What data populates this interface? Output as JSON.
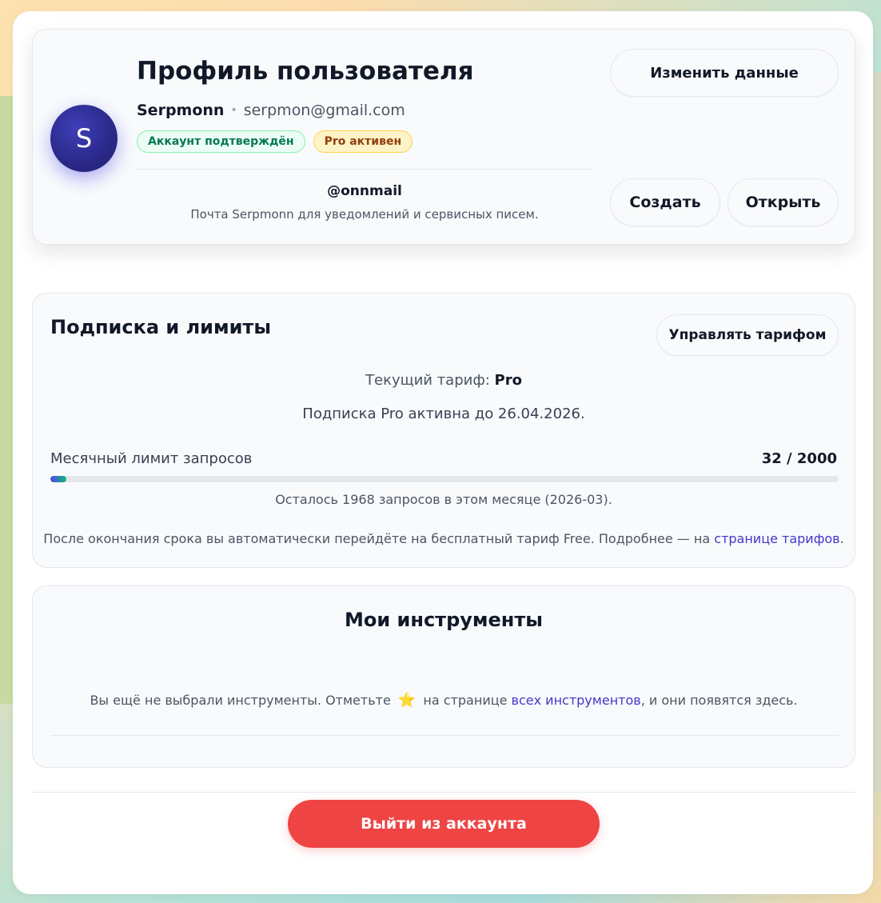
{
  "profile": {
    "title": "Профиль пользователя",
    "avatar_letter": "S",
    "username": "Serpmonn",
    "email": "serpmon@gmail.com",
    "badges": {
      "verified": "Аккаунт подтверждён",
      "pro": "Pro активен"
    },
    "mail_handle": "@onnmail",
    "mail_description": "Почта Serpmonn для уведомлений и сервисных писем.",
    "edit_button": "Изменить данные",
    "create_button": "Создать",
    "open_button": "Открыть"
  },
  "subscription": {
    "title": "Подписка и лимиты",
    "manage_button": "Управлять тарифом",
    "current_tariff_label": "Текущий тариф:",
    "current_tariff_value": "Pro",
    "active_until_text": "Подписка Pro активна до 26.04.2026.",
    "limit_label": "Месячный лимит запросов",
    "limit_value": "32 / 2000",
    "limit_used": 32,
    "limit_total": 2000,
    "remaining_text": "Осталось 1968 запросов в этом месяце (2026-03).",
    "after_text": "После окончания срока вы автоматически перейдёте на бесплатный тариф Free. Подробнее — на",
    "tariffs_link": "странице тарифов",
    "after_text_end": "."
  },
  "tools": {
    "title": "Мои инструменты",
    "empty_text_start": "Вы ещё не выбрали инструменты. Отметьте",
    "empty_text_middle": "на странице",
    "all_tools_link": "всех инструментов",
    "empty_text_end": ", и они появятся здесь.",
    "star_icon": "⭐"
  },
  "logout_button": "Выйти из аккаунта",
  "colors": {
    "accent": "#4338ca",
    "danger": "#ef4444",
    "success": "#047857",
    "warning": "#92400e"
  }
}
